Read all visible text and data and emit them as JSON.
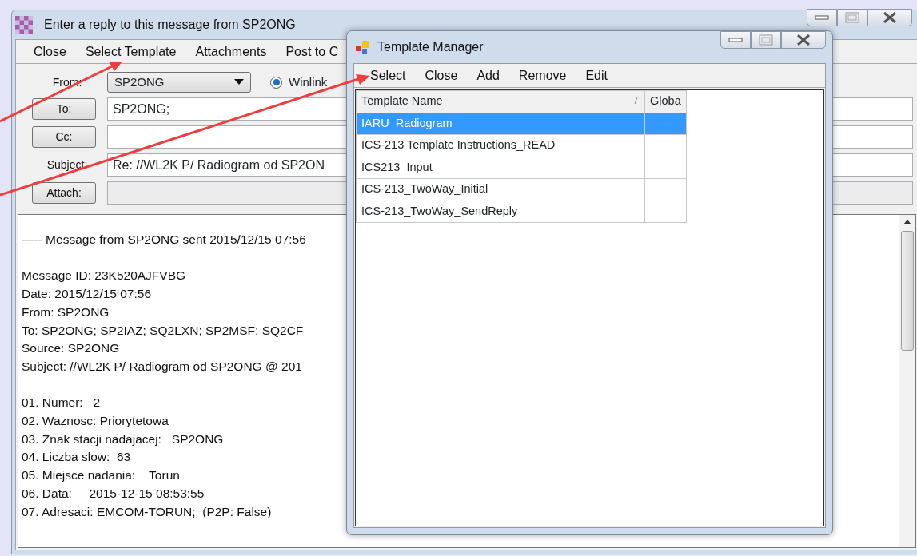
{
  "window": {
    "title": "Enter a reply to this message from SP2ONG",
    "menu": [
      "Close",
      "Select Template",
      "Attachments",
      "Post to C"
    ]
  },
  "form": {
    "from": {
      "label": "From:",
      "value": "SP2ONG"
    },
    "mode": {
      "label": "Winlink",
      "selected": true
    },
    "to": {
      "label": "To:",
      "value": "SP2ONG;"
    },
    "cc": {
      "label": "Cc:"
    },
    "subject": {
      "label": "Subject:",
      "value": "Re: //WL2K P/ Radiogram od SP2ON"
    },
    "attach": {
      "label": "Attach:"
    }
  },
  "body": {
    "paragraphs": [
      [
        "----- Message from SP2ONG sent 2015/12/15 07:56"
      ],
      [
        "Message ID: 23K520AJFVBG",
        "Date: 2015/12/15 07:56",
        "From: SP2ONG",
        "To: SP2ONG; SP2IAZ; SQ2LXN; SP2MSF; SQ2CF",
        "Source: SP2ONG",
        "Subject: //WL2K P/ Radiogram od SP2ONG @ 201"
      ],
      [
        "01. Numer:   2",
        "02. Waznosc: Priorytetowa",
        "03. Znak stacji nadajacej:   SP2ONG",
        "04. Liczba slow:  63",
        "05. Miejsce nadania:    Torun",
        "06. Data:     2015-12-15 08:53:55",
        "07. Adresaci: EMCOM-TORUN;  (P2P: False)"
      ]
    ]
  },
  "dialog": {
    "title": "Template Manager",
    "menu": [
      "Select",
      "Close",
      "Add",
      "Remove",
      "Edit"
    ],
    "columns": [
      "Template Name",
      "Globa"
    ],
    "rows": [
      {
        "name": "IARU_Radiogram",
        "selected": true
      },
      {
        "name": "ICS-213 Template Instructions_READ",
        "selected": false
      },
      {
        "name": "ICS213_Input",
        "selected": false
      },
      {
        "name": "ICS-213_TwoWay_Initial",
        "selected": false
      },
      {
        "name": "ICS-213_TwoWay_SendReply",
        "selected": false
      }
    ]
  }
}
